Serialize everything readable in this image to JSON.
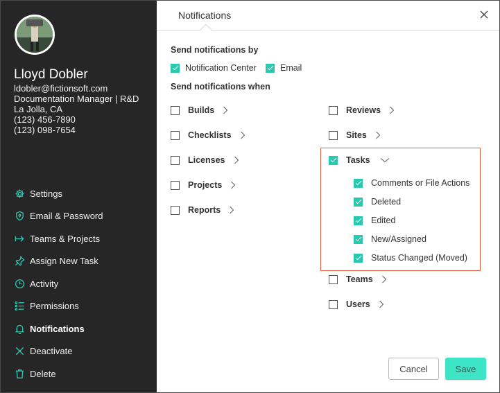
{
  "user": {
    "name": "Lloyd Dobler",
    "email": "ldobler@fictionsoft.com",
    "title": "Documentation Manager | R&D",
    "location": "La Jolla, CA",
    "phone1": "(123) 456-7890",
    "phone2": "(123) 098-7654"
  },
  "menu": [
    {
      "label": "Settings",
      "icon": "gear-icon"
    },
    {
      "label": "Email & Password",
      "icon": "shield-icon"
    },
    {
      "label": "Teams & Projects",
      "icon": "arrow-right-icon"
    },
    {
      "label": "Assign New Task",
      "icon": "pin-icon"
    },
    {
      "label": "Activity",
      "icon": "clock-icon"
    },
    {
      "label": "Permissions",
      "icon": "list-icon"
    },
    {
      "label": "Notifications",
      "icon": "bell-icon",
      "active": true
    },
    {
      "label": "Deactivate",
      "icon": "x-icon"
    },
    {
      "label": "Delete",
      "icon": "trash-icon"
    }
  ],
  "header": {
    "title": "Notifications"
  },
  "send_by": {
    "label": "Send notifications by",
    "options": [
      {
        "label": "Notification Center",
        "checked": true
      },
      {
        "label": "Email",
        "checked": true
      }
    ]
  },
  "send_when": {
    "label": "Send notifications when",
    "left": [
      {
        "label": "Builds",
        "checked": false
      },
      {
        "label": "Checklists",
        "checked": false
      },
      {
        "label": "Licenses",
        "checked": false
      },
      {
        "label": "Projects",
        "checked": false
      },
      {
        "label": "Reports",
        "checked": false
      }
    ],
    "right_top": [
      {
        "label": "Reviews",
        "checked": false
      },
      {
        "label": "Sites",
        "checked": false
      }
    ],
    "tasks": {
      "label": "Tasks",
      "checked": true,
      "expanded": true,
      "children": [
        {
          "label": "Comments or File Actions",
          "checked": true
        },
        {
          "label": "Deleted",
          "checked": true
        },
        {
          "label": "Edited",
          "checked": true
        },
        {
          "label": "New/Assigned",
          "checked": true
        },
        {
          "label": "Status Changed (Moved)",
          "checked": true
        }
      ]
    },
    "right_bottom": [
      {
        "label": "Teams",
        "checked": false
      },
      {
        "label": "Users",
        "checked": false
      }
    ]
  },
  "buttons": {
    "cancel": "Cancel",
    "save": "Save"
  },
  "colors": {
    "accent": "#29c9b0",
    "save": "#3de5c6",
    "sidebar": "#262626",
    "highlight": "#e05a3a"
  }
}
